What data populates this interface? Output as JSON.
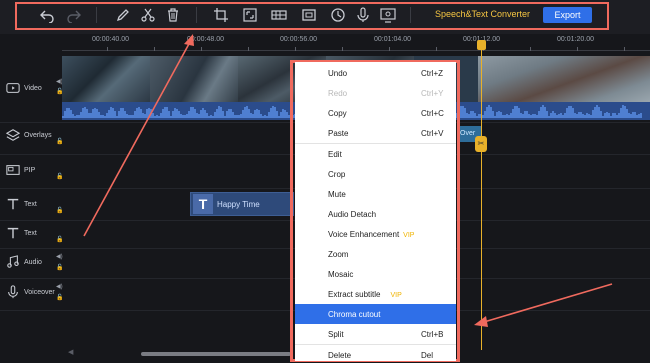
{
  "toolbar": {
    "icons": [
      "undo-icon",
      "redo-icon",
      "pencil-icon",
      "scissors-icon",
      "trash-icon",
      "crop-icon",
      "expand-icon",
      "mosaic-icon",
      "freeze-frame-icon",
      "clock-icon",
      "microphone-icon",
      "screen-record-icon"
    ],
    "speech_label": "Speech&Text Converter",
    "export_label": "Export"
  },
  "ruler": {
    "labels": [
      "00:00:40.00",
      "00:00:48.00",
      "00:00:56.00",
      "00:01:04.00",
      "00:01:12.00",
      "00:01:20.00"
    ]
  },
  "tracks": {
    "video": "Video",
    "overlays": "Overlays",
    "pip": "PIP",
    "text1": "Text",
    "text2": "Text",
    "audio": "Audio",
    "voiceover": "Voiceover"
  },
  "clips": {
    "text_clip": "Happy Time",
    "overlay_clip": "Over"
  },
  "context_menu": {
    "undo": {
      "label": "Undo",
      "shortcut": "Ctrl+Z"
    },
    "redo": {
      "label": "Redo",
      "shortcut": "Ctrl+Y"
    },
    "copy": {
      "label": "Copy",
      "shortcut": "Ctrl+C"
    },
    "paste": {
      "label": "Paste",
      "shortcut": "Ctrl+V"
    },
    "edit": {
      "label": "Edit"
    },
    "crop": {
      "label": "Crop"
    },
    "mute": {
      "label": "Mute"
    },
    "audio_detach": {
      "label": "Audio Detach"
    },
    "voice_enhancement": {
      "label": "Voice Enhancement",
      "badge": "VIP"
    },
    "zoom": {
      "label": "Zoom"
    },
    "mosaic": {
      "label": "Mosaic"
    },
    "extract_subtitle": {
      "label": "Extract subtitle",
      "badge": "VIP"
    },
    "chroma_cutout": {
      "label": "Chroma cutout"
    },
    "split": {
      "label": "Split",
      "shortcut": "Ctrl+B"
    },
    "delete": {
      "label": "Delete",
      "shortcut": "Del"
    }
  },
  "colors": {
    "accent": "#2f6fe8",
    "annotation": "#f06a5e",
    "playhead": "#e8b12a",
    "vip": "#f0b400"
  }
}
